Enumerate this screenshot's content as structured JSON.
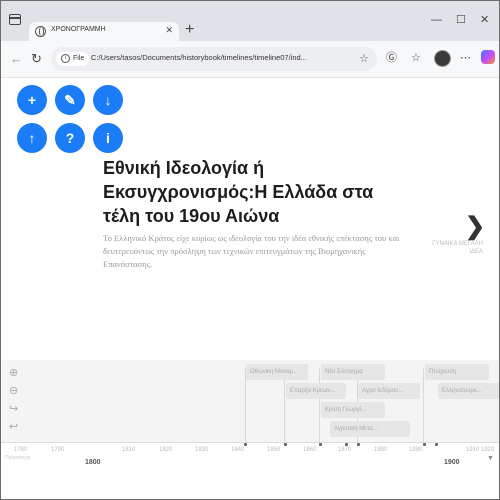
{
  "browser": {
    "tab_title": "ΧΡΟΝΟΓΡΑΜΜΗ",
    "url_chip": "File",
    "url": "C:/Users/tasos/Documents/historybook/timelines/timeline07/ind...",
    "icons": [
      "window-icon",
      "globe-icon",
      "close-icon",
      "plus-icon",
      "minimize-icon",
      "maximize-icon",
      "back-icon",
      "refresh-icon",
      "info-icon",
      "star-icon",
      "reader-icon",
      "favorites-icon",
      "profile-avatar",
      "copilot-icon"
    ]
  },
  "colors": {
    "accent": "#1a7cf7",
    "headline": "#1d1d1d"
  },
  "fabs": [
    {
      "glyph": "+",
      "name": "add-button"
    },
    {
      "glyph": "✎",
      "name": "edit-button"
    },
    {
      "glyph": "↓",
      "name": "download-button"
    },
    {
      "glyph": "↑",
      "name": "upload-button"
    },
    {
      "glyph": "?",
      "name": "help-button"
    },
    {
      "glyph": "i",
      "name": "info-button"
    }
  ],
  "slide": {
    "title": "Εθνική Ιδεολογία ή Εκσυγχρονισμός:Η Ελλάδα στα τέλη του 19ου Αιώνα",
    "description": "Το Ελληνικό Κράτος είχε κυρίως ως ιδεολογία του την ιδέα εθνικής επέκτασης του και δευτερευόντως την πρόσληψη των τεχνικών επιτευγμάτων της Βιομηχανικής Επανάστασης.",
    "next_label": "ΓΥΝΑΙΚΑ ΜΕΓΑΛΗ ΙΔΕΑ"
  },
  "timeline": {
    "markers": [
      "Οθωνικη Μοναρ...",
      "Νέο Σύνταγμα",
      "Επαρξα Κρεων...",
      "Αγρο Ιεδύμου...",
      "Κρίση Γεωργί...",
      "Αγροτική Μετα...",
      "Πτώχευση",
      "Ελληνοτουρκ..."
    ],
    "ticks": [
      "1780",
      "1790",
      "1810",
      "1820",
      "1830",
      "1840",
      "1850",
      "1860",
      "1870",
      "1880",
      "1890",
      "1910",
      "1920"
    ],
    "major_ticks": [
      "1800",
      "1900"
    ],
    "era_label": "Παλαιότερη"
  }
}
